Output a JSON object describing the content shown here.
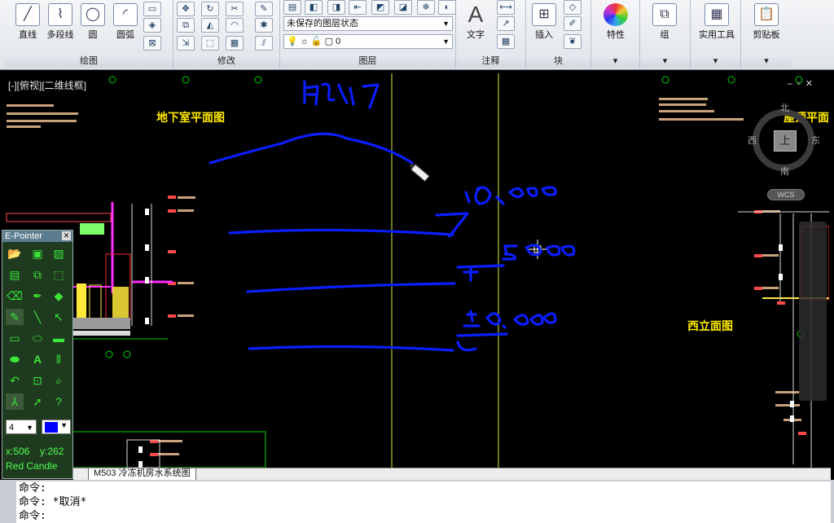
{
  "ribbon": {
    "draw": {
      "line": "直线",
      "polyline": "多段线",
      "circle": "圆",
      "arc": "圆弧",
      "panel": "绘图"
    },
    "modify": {
      "panel": "修改"
    },
    "layers": {
      "state_value": "未保存的图层状态",
      "layer_value": "0",
      "panel": "图层"
    },
    "annotation": {
      "text": "文字",
      "panel": "注释"
    },
    "block": {
      "insert": "插入",
      "panel": "块"
    },
    "properties": {
      "label": "特性"
    },
    "group": {
      "label": "组"
    },
    "utilities": {
      "label": "实用工具"
    },
    "clipboard": {
      "label": "剪贴板"
    }
  },
  "viewport": {
    "tag": "[-][俯视][二维线框]",
    "labels": {
      "basement": "地下室平面图",
      "roof": "屋顶平面",
      "west": "西立面图"
    },
    "viewcube": {
      "north": "北",
      "south": "南",
      "east": "东",
      "west": "西",
      "top": "上",
      "wcs": "WCS"
    }
  },
  "tabs": {
    "active": "M503 冷冻机房水系统图"
  },
  "command": {
    "lines": [
      "命令:",
      "命令: *取消*",
      "命令:"
    ]
  },
  "epointer": {
    "title": "E-Pointer",
    "size_value": "4",
    "pen_color": "#0000ff",
    "x_readout": "x:506",
    "y_readout": "y:262",
    "name": "Red Candle"
  },
  "colors": {
    "ink": "#0a1eff",
    "cad_green": "#00d400",
    "cad_yellow": "#ffea00",
    "guide_yellow": "#d8f03a"
  }
}
